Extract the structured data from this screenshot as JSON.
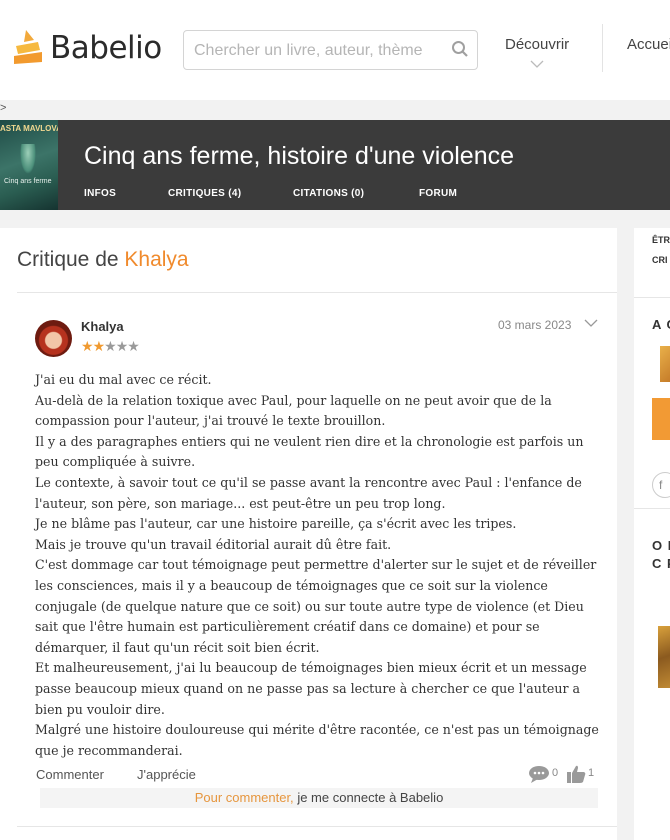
{
  "header": {
    "logo_text": "Babelio",
    "search_placeholder": "Chercher un livre, auteur, thème",
    "nav_decouvrir": "Découvrir",
    "nav_accueil": "Accueil",
    "breadcrumb_marker": ">"
  },
  "book": {
    "cover_author": "ASTA MAVLOVA",
    "cover_title": "Cinq ans ferme",
    "title": "Cinq ans ferme, histoire d'une violence",
    "tabs": [
      "INFOS",
      "CRITIQUES (4)",
      "CITATIONS (0)",
      "FORUM"
    ]
  },
  "critique": {
    "heading_prefix": "Critique de",
    "heading_author": "Khalya",
    "reviewer": "Khalya",
    "rating": 2,
    "rating_max": 5,
    "date": "03 mars 2023",
    "paragraphs": [
      "J'ai eu du mal avec ce récit.",
      "Au-delà de la relation toxique avec Paul, pour laquelle on ne peut avoir que de la compassion pour l'auteur, j'ai trouvé le texte brouillon.",
      "Il y a des paragraphes entiers qui ne veulent rien dire et la chronologie est parfois un peu compliquée à suivre.",
      "Le contexte, à savoir tout ce qu'il se passe avant la rencontre avec Paul : l'enfance de l'auteur, son père, son mariage... est peut-être un peu trop long.",
      "Je ne blâme pas l'auteur, car une histoire pareille, ça s'écrit avec les tripes.",
      "Mais je trouve qu'un travail éditorial aurait dû être fait.",
      "C'est dommage car tout témoignage peut permettre d'alerter sur le sujet et de réveiller les consciences, mais il y a beaucoup de témoignages que ce soit sur la violence conjugale (de quelque nature que ce soit) ou sur toute autre type de violence (et Dieu sait que l'être humain est particulièrement créatif dans ce domaine) et pour se démarquer, il faut qu'un récit soit bien écrit.",
      "Et malheureusement, j'ai lu beaucoup de témoignages bien mieux écrit et un message passe beaucoup mieux quand on ne passe pas sa lecture à chercher ce que l'auteur a bien pu vouloir dire.",
      "Malgré une histoire douloureuse qui mérite d'être racontée, ce n'est pas un témoignage que je recommanderai."
    ],
    "actions": {
      "comment": "Commenter",
      "like": "J'apprécie",
      "comment_count": "0",
      "like_count": "1"
    },
    "login_prompt": {
      "prefix": "Pour commenter,",
      "link": "je me connecte à Babelio"
    }
  },
  "sidebar": {
    "line1": "ÊTR",
    "line2": "CRI",
    "section1": "A C",
    "section2_line1": "O N",
    "section2_line2": "C P",
    "social_icon": "f"
  },
  "colors": {
    "accent": "#f08a2c",
    "banner": "#3b3b3b",
    "star_on": "#f09a30",
    "star_off": "#9a9a9a"
  }
}
